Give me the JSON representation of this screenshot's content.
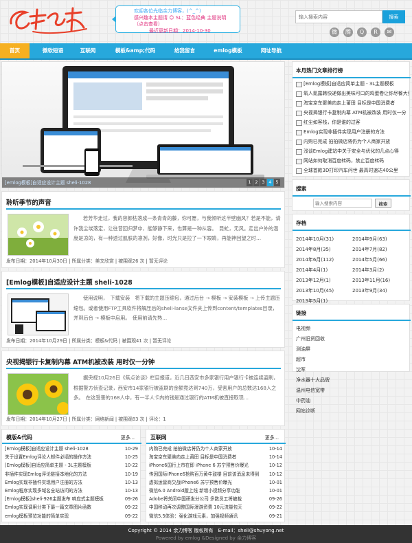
{
  "header": {
    "logo_text": "余力博客",
    "notice": [
      "欢迎各位光临余力博客，(^_^)",
      "感兴趣本主题请 ☺ SL：蓝色经典 主题说明（点击查看）",
      "最近更新日期：2014-10-30"
    ],
    "search_placeholder": "输入搜索内容",
    "search_button": "搜索",
    "socials": [
      "weibo-icon",
      "tencent-weibo-icon",
      "qq-icon",
      "rss-icon",
      "mail-icon"
    ]
  },
  "nav": {
    "items": [
      "首页",
      "微软短语",
      "互联网",
      "模板&amp;代码",
      "给我留言",
      "emlog模板",
      "网址导航"
    ]
  },
  "slider": {
    "caption": "[emlog模板]自适应设计主题 sheli-1028",
    "dots": [
      "1",
      "2",
      "3",
      "4",
      "5"
    ],
    "active": "4"
  },
  "posts": [
    {
      "title": "聆听季节的声音",
      "excerpt": "若芳华走过，我的容颜枯落成一条青青的藤，你可愿，与我倾听这半壁幽风？若是不能，请许我尘埃落定，让往昔回归梦中，能够静下来，也算是一种从容。　昆虻，无风。走出户外的温度是凉的，有一种透过肌肤的凛冽，好像，时光只是拉了一下眼睛，再能神回望之时…",
      "meta": "发布日期：2014年10月30日 | 所属分类：美文欣赏 | 被围观26 次 | 暂无评论",
      "thumb": "flowers"
    },
    {
      "title": "[Emlog模板]自适应设计主题 sheli-1028",
      "excerpt": "使用说明，　下载安装　将下载的主题压缩包，通过后台 → 模板 → 安装模板 → 上传主题压缩包。或者使用FTP工具软件将解压后的sheli-lanse文件夹上传到content/templates目录，并到后台 → 模板中启用。　使用前请先熟…",
      "meta": "发布日期：2014年10月29日 | 所属分类：模板&代码 | 被围观41 次 | 暂无评论",
      "thumb": "screens"
    },
    {
      "title": "央视揭银行卡复制内幕 ATM机被改装 用时仅一分钟",
      "excerpt": "据央视10月26日《焦点访谈》栏目报道，近几日西安市多家银行用户银行卡被连续盗刷，根据警方侦查记录，西安市14家银行被盗刷的金额竟达到740万，受害用户的总数达168人之多。　在这受害的168人中，有一半人卡内的钱是通过银行的ATM机被直接取现…",
      "meta": "发布日期：2014年10月27日 | 所属分类：网络新闻 | 被围观83 次 | 评论：1",
      "thumb": "sunflowers"
    }
  ],
  "hot": {
    "title": "本月热门文章排行榜",
    "items": [
      "[Emlog模板]自适应简单主题 - 3L主题模板",
      "氧人氮露韩快递做出美味可口的鸡蛋卷让你尽餐大菜",
      "淘宝京东聚美向走上莆田 目标是中国消费者",
      "央视揭银行卡复制内幕 ATM机被改装 用时仅一分",
      "红尘如客栈，你是谁的过客",
      "Emlog实现非插件实现用户注册的方法",
      "内购已完成 拍拍微店将仍为个人商家开放",
      "浅谈Emlog建站中关于安全与优化的几点心得",
      "网站如何取消百度转码，禁止百度转码",
      "全球首款3D打印汽车问世 最高时速达40公里"
    ]
  },
  "side_search": {
    "title": "搜索",
    "placeholder": "输入搜索内容",
    "button": "搜索"
  },
  "archive": {
    "title": "存档",
    "items": [
      "2014年10月(31)",
      "2014年9月(63)",
      "2014年8月(35)",
      "2014年7月(82)",
      "2014年6月(112)",
      "2014年5月(66)",
      "2014年4月(1)",
      "2014年3月(2)",
      "2013年12月(1)",
      "2013年11月(16)",
      "2013年10月(45)",
      "2013年9月(34)",
      "2013年5月(1)"
    ]
  },
  "links": {
    "title": "链接",
    "items": [
      "电视频",
      "广州旧货回收",
      "测油屏",
      "超市",
      "沈军",
      "净水器十大品牌",
      "温州电信宽带",
      "中药油",
      "网站诊断"
    ]
  },
  "box_left": {
    "title": "模版&代码",
    "more": "更多...",
    "items": [
      [
        "[Emlog模板]自适应设计主题 sheli-1028",
        "10-29"
      ],
      [
        "关于设置Emlog评论人邮件必填的操作方法",
        "10-25"
      ],
      [
        "[Emlog模板]自适应简单主题 - 3L主题模板",
        "10-22"
      ],
      [
        "非插件实现Emlog评论链接本地化的方法",
        "10-19"
      ],
      [
        "Emlog实现非插件实现用户注册的方法",
        "10-13"
      ],
      [
        "Emlog程序实现多域名全站访问的方法",
        "10-13"
      ],
      [
        "[Emlog模板]sheli-926主题发布 响应式主题模板",
        "09-26"
      ],
      [
        "Emlog实现调用分类下最一篇文章图片函数",
        "09-22"
      ],
      [
        "emlog模板预览功能的简单实现",
        "09-22"
      ]
    ]
  },
  "box_right": {
    "title": "互联网",
    "more": "更多...",
    "items": [
      [
        "内购已完成 拍拍微店将仍为个人商家开放",
        "10-14"
      ],
      [
        "淘宝京东聚美向走上莆田 目标是中国消费者",
        "10-14"
      ],
      [
        "iPhone6国行上市在即 iPhone 6 苏宁预售价曝光",
        "10-12"
      ],
      [
        "传因国际iPhone6抢购百万黄牛鼓楼 目前该消息未得到",
        "10-12"
      ],
      [
        "虚拟运营商欠战iPhone6 苏宁预售价曝光",
        "10-01"
      ],
      [
        "微信6.0 Android版上线 新增小视频分享功能",
        "10-01"
      ],
      [
        "Adobe将关闭中国研发分公司 多数员工将被裁",
        "09-26"
      ],
      [
        "中国移动再次调整国际漫游资费 10元流量包天",
        "09-22"
      ],
      [
        "微信5.5体验：强化游戏元素，加强视频通讯",
        "09-21"
      ]
    ]
  },
  "footer": {
    "line1": "Copyright © 2014 余力博客 版权所有　E-mail：sheli@shuyong.net",
    "line2": "Powered by emlog &Designed by 余力博客"
  },
  "colors": {
    "accent": "#27a8dc",
    "nav_active": "#f6b021",
    "logo": "#e8402a"
  }
}
